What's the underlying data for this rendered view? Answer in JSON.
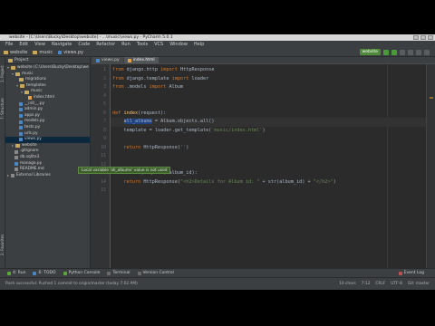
{
  "window": {
    "title": "website - [C:\\Users\\Bucky\\Desktop\\website] - ...\\music\\views.py - PyCharm 5.0.1"
  },
  "menu": [
    "File",
    "Edit",
    "View",
    "Navigate",
    "Code",
    "Refactor",
    "Run",
    "Tools",
    "VCS",
    "Window",
    "Help"
  ],
  "breadcrumbs": [
    "website",
    "music",
    "views.py"
  ],
  "run_config": "website",
  "project_panel": {
    "title": "Project",
    "items": [
      {
        "label": "website (C:\\Users\\Bucky\\Desktop\\we",
        "indent": 0,
        "type": "folder"
      },
      {
        "label": "music",
        "indent": 1,
        "type": "folder"
      },
      {
        "label": "migrations",
        "indent": 2,
        "type": "folder"
      },
      {
        "label": "templates",
        "indent": 2,
        "type": "folder"
      },
      {
        "label": "music",
        "indent": 3,
        "type": "folder"
      },
      {
        "label": "index.html",
        "indent": 4,
        "type": "html"
      },
      {
        "label": "__init__.py",
        "indent": 2,
        "type": "py"
      },
      {
        "label": "admin.py",
        "indent": 2,
        "type": "py"
      },
      {
        "label": "apps.py",
        "indent": 2,
        "type": "py"
      },
      {
        "label": "models.py",
        "indent": 2,
        "type": "py"
      },
      {
        "label": "tests.py",
        "indent": 2,
        "type": "py"
      },
      {
        "label": "urls.py",
        "indent": 2,
        "type": "py"
      },
      {
        "label": "views.py",
        "indent": 2,
        "type": "py",
        "selected": true
      },
      {
        "label": "website",
        "indent": 1,
        "type": "folder"
      },
      {
        "label": ".gitignore",
        "indent": 1,
        "type": "file"
      },
      {
        "label": "db.sqlite3",
        "indent": 1,
        "type": "file"
      },
      {
        "label": "manage.py",
        "indent": 1,
        "type": "py"
      },
      {
        "label": "README.md",
        "indent": 1,
        "type": "file"
      },
      {
        "label": "External Libraries",
        "indent": 0,
        "type": "lib"
      }
    ]
  },
  "left_strip": {
    "project": "1: Project",
    "structure": "7: Structure",
    "favorites": "2: Favorites"
  },
  "editor": {
    "tabs": [
      {
        "label": "views.py",
        "active": false
      },
      {
        "label": "index.html",
        "active": true
      }
    ],
    "line_numbers": [
      "1",
      "2",
      "3",
      "4",
      "5",
      "6",
      "7",
      "8",
      "9",
      "10",
      "11",
      "12",
      "13",
      "14",
      "15"
    ],
    "tooltip": "Local variable 'all_albums' value is not used",
    "code": {
      "l1a": "from",
      "l1b": " django.http ",
      "l1c": "import",
      "l1d": " HttpResponse",
      "l2a": "from",
      "l2b": " django.template ",
      "l2c": "import",
      "l2d": " loader",
      "l3a": "from",
      "l3b": " .models ",
      "l3c": "import",
      "l3d": " Album",
      "l6a": "def ",
      "l6b": "index",
      "l6c": "(request):",
      "l7a": "    ",
      "l7b": "all_albums",
      "l7c": " = Album.objects.all()",
      "l8a": "    template = loader.get_template(",
      "l8b": "'music/index.html'",
      "l8c": ")",
      "l10a": "    ",
      "l10b": "return",
      "l10c": " HttpResponse(",
      "l10d": "''",
      "l10e": ")",
      "l13a": "def ",
      "l13b": "detail",
      "l13c": "(request, album_id):",
      "l14a": "    ",
      "l14b": "return",
      "l14c": " HttpResponse(",
      "l14d": "\"<h2>Details for Album id: \"",
      "l14e": " + str(album_id) + ",
      "l14f": "\"</h2>\"",
      "l14g": ")"
    }
  },
  "bottom_tools": [
    "4: Run",
    "6: TODO",
    "Python Console",
    "Terminal",
    "Version Control"
  ],
  "event_log": "Event Log",
  "status": {
    "message": "Push successful: Pushed 1 commit to origin/master (today 7:02 AM)",
    "chars": "10 chars",
    "position": "7:12",
    "line_sep": "CRLF",
    "encoding": "UTF-8",
    "git": "Git: master"
  },
  "colors": {
    "background": "#2b2b2b",
    "keyword": "#cc7832",
    "string": "#6a8759",
    "function": "#ffc66d"
  }
}
